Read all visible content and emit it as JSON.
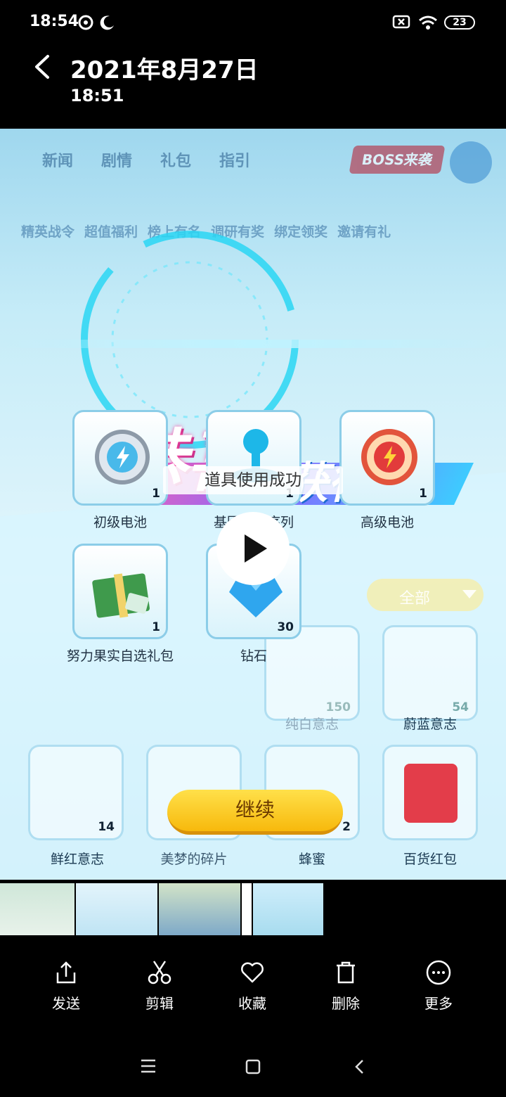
{
  "status_bar": {
    "time": "18:54",
    "battery": "23"
  },
  "header": {
    "date": "2021年8月27日",
    "time": "18:51"
  },
  "game": {
    "top_nav": [
      "新闻",
      "剧情",
      "礼包",
      "指引"
    ],
    "boss_label": "BOSS来袭",
    "second_row": [
      "精英战令",
      "超值福利",
      "榜上有名",
      "调研有奖",
      "绑定领奖",
      "邀请有礼"
    ],
    "title_main": "恭喜",
    "title_sub": "获得",
    "toast": "道具使用成功",
    "filter": "全部",
    "rewards": [
      {
        "name": "初级电池",
        "count": "1",
        "icon": "battery-silver-icon"
      },
      {
        "name": "基因稳定序列",
        "count": "1",
        "icon": "gene-molecule-icon"
      },
      {
        "name": "高级电池",
        "count": "1",
        "icon": "battery-red-icon"
      },
      {
        "name": "努力果实自选礼包",
        "count": "1",
        "icon": "gift-box-icon"
      },
      {
        "name": "钻石",
        "count": "30",
        "icon": "diamond-icon"
      }
    ],
    "bg_items": [
      {
        "name": "纯白意志",
        "count": "150"
      },
      {
        "name": "蔚蓝意志",
        "count": "54"
      },
      {
        "name": "鲜红意志",
        "count": "14"
      },
      {
        "name": "美梦的碎片",
        "count": ""
      },
      {
        "name": "蜂蜜",
        "count": "2"
      },
      {
        "name": "百货红包",
        "count": ""
      }
    ],
    "continue": "继续"
  },
  "actions": [
    {
      "label": "发送",
      "icon": "share-icon"
    },
    {
      "label": "剪辑",
      "icon": "scissors-icon"
    },
    {
      "label": "收藏",
      "icon": "heart-icon"
    },
    {
      "label": "删除",
      "icon": "trash-icon"
    },
    {
      "label": "更多",
      "icon": "more-icon"
    }
  ],
  "colors": {
    "accent_yellow": "#f7b90c",
    "title_pink": "#ff4fa8",
    "panel_blue": "#8ccde8"
  }
}
